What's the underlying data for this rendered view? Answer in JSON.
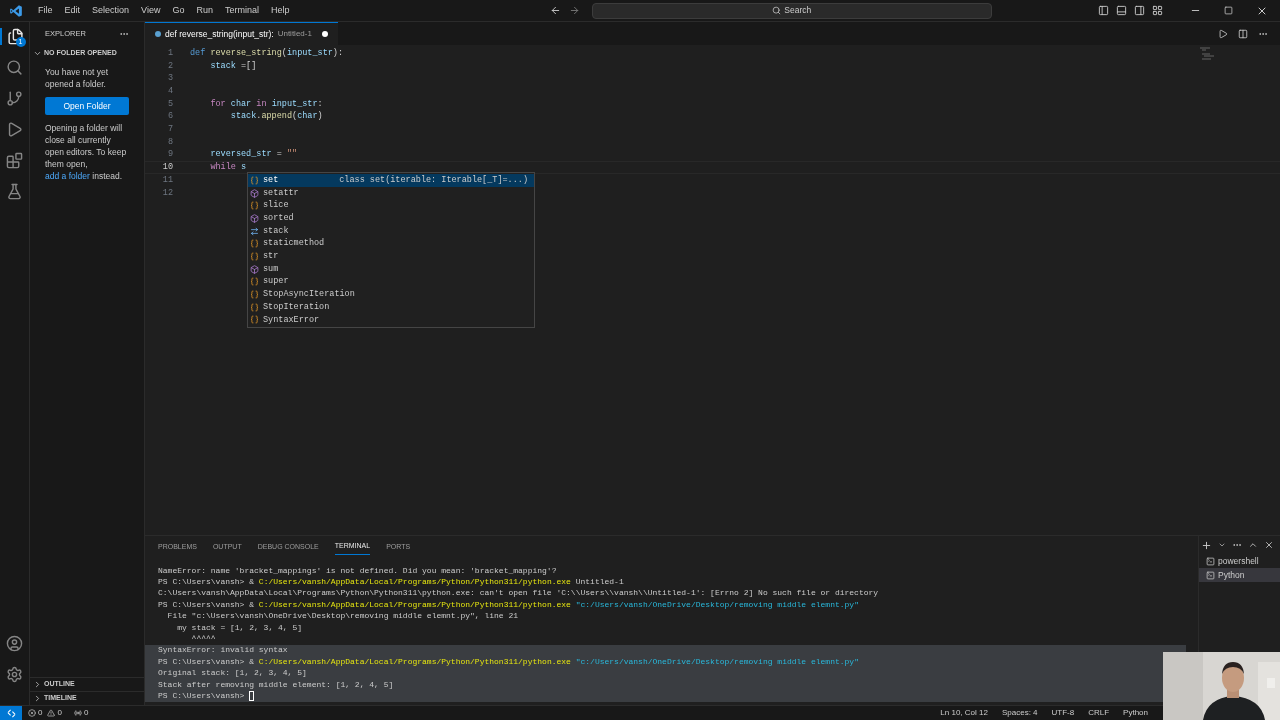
{
  "menu": [
    "File",
    "Edit",
    "Selection",
    "View",
    "Go",
    "Run",
    "Terminal",
    "Help"
  ],
  "search": {
    "placeholder": "Search"
  },
  "activity": [
    {
      "kind": "files",
      "selected": true,
      "badge": "1"
    },
    {
      "kind": "search",
      "selected": false
    },
    {
      "kind": "branch",
      "selected": false
    },
    {
      "kind": "debug",
      "selected": false
    },
    {
      "kind": "extensions",
      "selected": false
    },
    {
      "kind": "flask",
      "selected": false
    }
  ],
  "sidebar": {
    "title": "EXPLORER",
    "section": "NO FOLDER OPENED",
    "message": "You have not yet opened a folder.",
    "button": "Open Folder",
    "note_before": "Opening a folder will close all currently open editors. To keep them open,",
    "note_link": "add a folder",
    "note_after": "instead.",
    "bottom_sections": [
      {
        "label": "OUTLINE",
        "expanded": false
      },
      {
        "label": "TIMELINE",
        "expanded": false
      }
    ]
  },
  "tab": {
    "title": "def reverse_string(input_str):",
    "file": "Untitled-1",
    "dirty": true
  },
  "code": [
    {
      "number": "1",
      "tokens": [
        {
          "kind": "keyword",
          "text": "def"
        },
        {
          "kind": "function",
          "text": " reverse_string"
        },
        {
          "kind": "plain",
          "text": "("
        },
        {
          "kind": "variable",
          "text": "input_str"
        },
        {
          "kind": "plain",
          "text": "):"
        }
      ]
    },
    {
      "number": "2",
      "tokens": [
        {
          "kind": "variable",
          "text": "    stack"
        },
        {
          "kind": "plain",
          "text": " =[]"
        }
      ]
    },
    {
      "number": "3"
    },
    {
      "number": "4"
    },
    {
      "number": "5",
      "tokens": [
        {
          "kind": "control",
          "text": "    for"
        },
        {
          "kind": "variable",
          "text": " char"
        },
        {
          "kind": "control",
          "text": " in"
        },
        {
          "kind": "variable",
          "text": " input_str"
        },
        {
          "kind": "plain",
          "text": ":"
        }
      ]
    },
    {
      "number": "6",
      "tokens": [
        {
          "kind": "variable",
          "text": "        stack"
        },
        {
          "kind": "plain",
          "text": "."
        },
        {
          "kind": "function",
          "text": "append"
        },
        {
          "kind": "plain",
          "text": "("
        },
        {
          "kind": "variable",
          "text": "char"
        },
        {
          "kind": "plain",
          "text": ")"
        }
      ]
    },
    {
      "number": "7"
    },
    {
      "number": "8"
    },
    {
      "number": "9",
      "tokens": [
        {
          "kind": "variable",
          "text": "    reversed_str"
        },
        {
          "kind": "plain",
          "text": " ="
        },
        {
          "kind": "string",
          "text": " \"\""
        }
      ]
    },
    {
      "number": "10",
      "current": true,
      "tokens": [
        {
          "kind": "control",
          "text": "    while"
        },
        {
          "kind": "variable",
          "text": " s"
        }
      ]
    },
    {
      "number": "11"
    },
    {
      "number": "12"
    }
  ],
  "suggestions": [
    {
      "kind": "class",
      "label": "set",
      "selected": true,
      "detail": "class set(iterable: Iterable[_T]=...)"
    },
    {
      "kind": "method",
      "label": "setattr",
      "selected": false
    },
    {
      "kind": "class",
      "label": "slice",
      "selected": false
    },
    {
      "kind": "method",
      "label": "sorted",
      "selected": false
    },
    {
      "kind": "variable",
      "label": "stack",
      "selected": false
    },
    {
      "kind": "class",
      "label": "staticmethod",
      "selected": false
    },
    {
      "kind": "class",
      "label": "str",
      "selected": false
    },
    {
      "kind": "method",
      "label": "sum",
      "selected": false
    },
    {
      "kind": "class",
      "label": "super",
      "selected": false
    },
    {
      "kind": "class",
      "label": "StopAsyncIteration",
      "selected": false
    },
    {
      "kind": "class",
      "label": "StopIteration",
      "selected": false
    },
    {
      "kind": "class",
      "label": "SyntaxError",
      "selected": false
    }
  ],
  "panel_tabs": [
    {
      "label": "PROBLEMS",
      "selected": false
    },
    {
      "label": "OUTPUT",
      "selected": false
    },
    {
      "label": "DEBUG CONSOLE",
      "selected": false
    },
    {
      "label": "TERMINAL",
      "selected": true
    },
    {
      "label": "PORTS",
      "selected": false
    }
  ],
  "terminal": [
    {
      "highlighted": false,
      "tokens": [
        {
          "kind": "plain",
          "text": "NameError: name 'bracket_mappings' is not defined. Did you mean: 'bracket_mapping'?"
        }
      ]
    },
    {
      "highlighted": false,
      "tokens": [
        {
          "kind": "plain",
          "text": "PS C:\\Users\\vansh> & "
        },
        {
          "kind": "path",
          "text": "C:/Users/vansh/AppData/Local/Programs/Python/Python311/python.exe"
        },
        {
          "kind": "plain",
          "text": " Untitled-1"
        }
      ]
    },
    {
      "highlighted": false,
      "tokens": [
        {
          "kind": "plain",
          "text": "C:\\Users\\vansh\\AppData\\Local\\Programs\\Python\\Python311\\python.exe: can't open file 'C:\\\\Users\\\\vansh\\\\Untitled-1': [Errno 2] No such file or directory"
        }
      ]
    },
    {
      "highlighted": false,
      "tokens": [
        {
          "kind": "plain",
          "text": "PS C:\\Users\\vansh> & "
        },
        {
          "kind": "path",
          "text": "C:/Users/vansh/AppData/Local/Programs/Python/Python311/python.exe"
        },
        {
          "kind": "arg",
          "text": " \"c:/Users/vansh/OneDrive/Desktop/removing middle elemnt.py\""
        }
      ]
    },
    {
      "highlighted": false,
      "tokens": [
        {
          "kind": "plain",
          "text": "  File \"c:\\Users\\vansh\\OneDrive\\Desktop\\removing middle elemnt.py\", line 21"
        }
      ]
    },
    {
      "highlighted": false,
      "tokens": [
        {
          "kind": "plain",
          "text": "    my stack = [1, 2, 3, 4, 5]"
        }
      ]
    },
    {
      "highlighted": false,
      "tokens": [
        {
          "kind": "plain",
          "text": "       ^^^^^"
        }
      ]
    },
    {
      "highlighted": true,
      "tokens": [
        {
          "kind": "plain",
          "text": "SyntaxError: invalid syntax"
        }
      ]
    },
    {
      "highlighted": true,
      "tokens": [
        {
          "kind": "plain",
          "text": "PS C:\\Users\\vansh> & "
        },
        {
          "kind": "path",
          "text": "C:/Users/vansh/AppData/Local/Programs/Python/Python311/python.exe"
        },
        {
          "kind": "arg",
          "text": " \"c:/Users/vansh/OneDrive/Desktop/removing middle elemnt.py\""
        }
      ]
    },
    {
      "highlighted": true,
      "tokens": [
        {
          "kind": "plain",
          "text": "Original stack: [1, 2, 3, 4, 5]"
        }
      ]
    },
    {
      "highlighted": true,
      "tokens": [
        {
          "kind": "plain",
          "text": "Stack after removing middle element: [1, 2, 4, 5]"
        }
      ]
    },
    {
      "highlighted": true,
      "cursor": true,
      "tokens": [
        {
          "kind": "plain",
          "text": "PS C:\\Users\\vansh>"
        }
      ]
    }
  ],
  "terminals": [
    {
      "label": "powershell",
      "selected": false
    },
    {
      "label": "Python",
      "selected": true
    }
  ],
  "status": {
    "errors": "0",
    "warnings": "0",
    "ports": "0",
    "right": [
      "Ln 10, Col 12",
      "Spaces: 4",
      "UTF-8",
      "CRLF",
      "Python"
    ]
  }
}
